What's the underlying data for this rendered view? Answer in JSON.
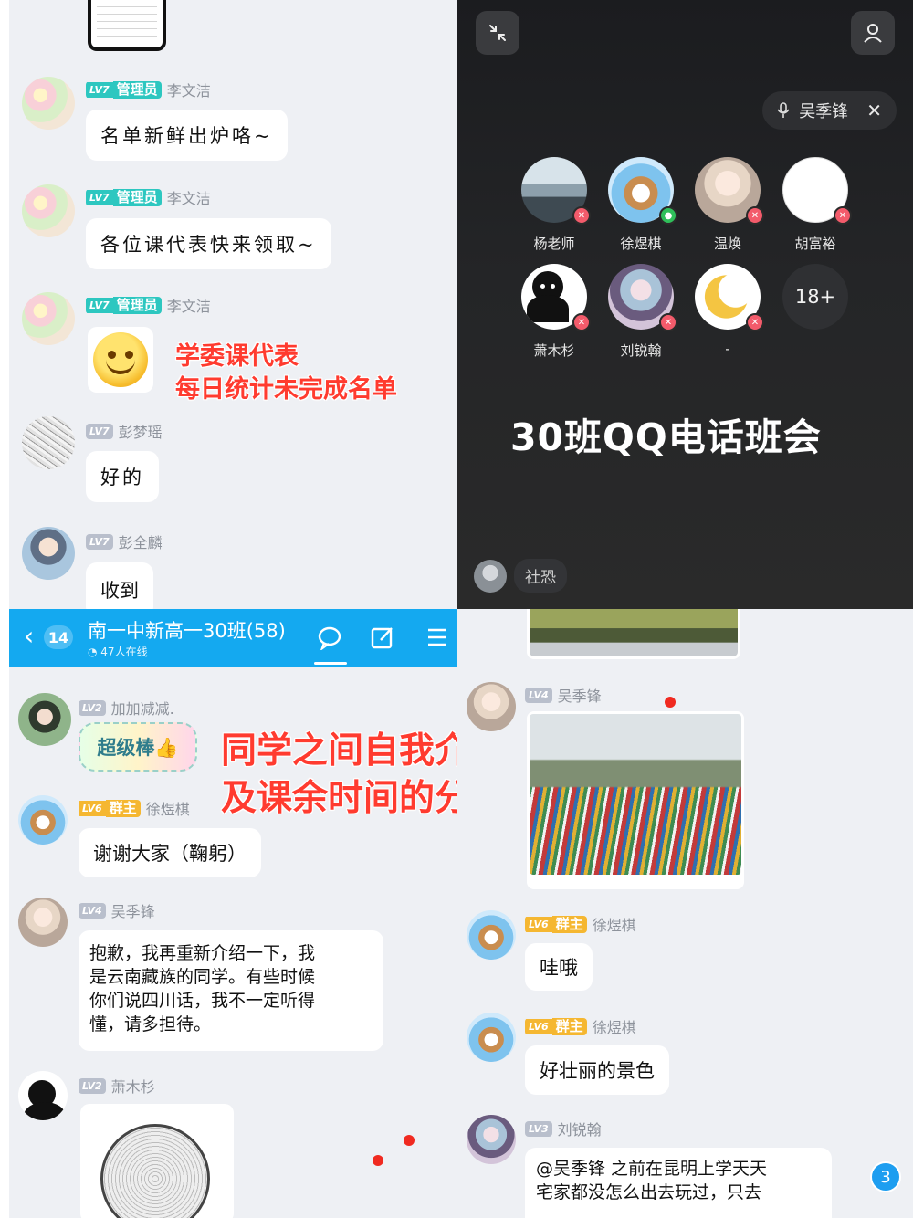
{
  "top_left": {
    "messages": [
      {
        "level": "LV7",
        "role": "管理员",
        "name": "李文洁",
        "text": "名单新鲜出炉咯~"
      },
      {
        "level": "LV7",
        "role": "管理员",
        "name": "李文洁",
        "text": "各位课代表快来领取~"
      },
      {
        "level": "LV7",
        "role": "管理员",
        "name": "李文洁",
        "text": ""
      },
      {
        "level": "LV7",
        "role": "",
        "name": "彭梦瑶",
        "text": "好的"
      },
      {
        "level": "LV7",
        "role": "",
        "name": "彭全麟",
        "text": "收到"
      }
    ],
    "overlay_text": [
      "学委课代表",
      "每日统计未完成名单"
    ]
  },
  "call": {
    "speaking_name": "吴季锋",
    "members": [
      {
        "name": "杨老师",
        "mic": "muted"
      },
      {
        "name": "徐煜棋",
        "mic": "on"
      },
      {
        "name": "温焕",
        "mic": "muted"
      },
      {
        "name": "胡富裕",
        "mic": "muted"
      },
      {
        "name": "萧木杉",
        "mic": "muted"
      },
      {
        "name": "刘锐翰",
        "mic": "muted"
      },
      {
        "name": "-",
        "mic": "muted"
      }
    ],
    "more_count": "18+",
    "title": "30班QQ电话班会",
    "bottom_user": "社恐"
  },
  "chat_header": {
    "back_badge": "14",
    "group_name": "南一中新高一30班(58)",
    "online": "47人在线"
  },
  "bottom_left": {
    "messages": [
      {
        "level": "LV2",
        "role": "",
        "name": "加加减减.",
        "sticker_text": "超级棒👍"
      },
      {
        "level": "LV6",
        "role": "群主",
        "name": "徐煜棋",
        "text": "谢谢大家（鞠躬）"
      },
      {
        "level": "LV4",
        "role": "",
        "name": "吴季锋",
        "text_lines": [
          "抱歉，我再重新介绍一下，我",
          "是云南藏族的同学。有些时候",
          "你们说四川话，我不一定听得",
          "懂，请多担待。"
        ]
      },
      {
        "level": "LV2",
        "role": "",
        "name": "萧木杉",
        "text": ""
      }
    ],
    "overlay_text": [
      "同学之间自我介绍",
      "及课余时间的分享"
    ]
  },
  "bottom_right": {
    "messages": [
      {
        "level": "LV4",
        "role": "",
        "name": "吴季锋",
        "text": ""
      },
      {
        "level": "LV6",
        "role": "群主",
        "name": "徐煜棋",
        "text": "哇哦"
      },
      {
        "level": "LV6",
        "role": "群主",
        "name": "徐煜棋",
        "text": "好壮丽的景色"
      },
      {
        "level": "LV3",
        "role": "",
        "name": "刘锐翰",
        "text_lines": [
          "@吴季锋 之前在昆明上学天天",
          "宅家都没怎么出去玩过，只去"
        ]
      }
    ],
    "unread_count": "3"
  },
  "colors": {
    "header_blue": "#14a9f0",
    "admin_teal": "#2dc7c0",
    "owner_gold": "#f5b731",
    "overlay_red": "#ff3b2f",
    "call_bg": "#1f2022"
  }
}
